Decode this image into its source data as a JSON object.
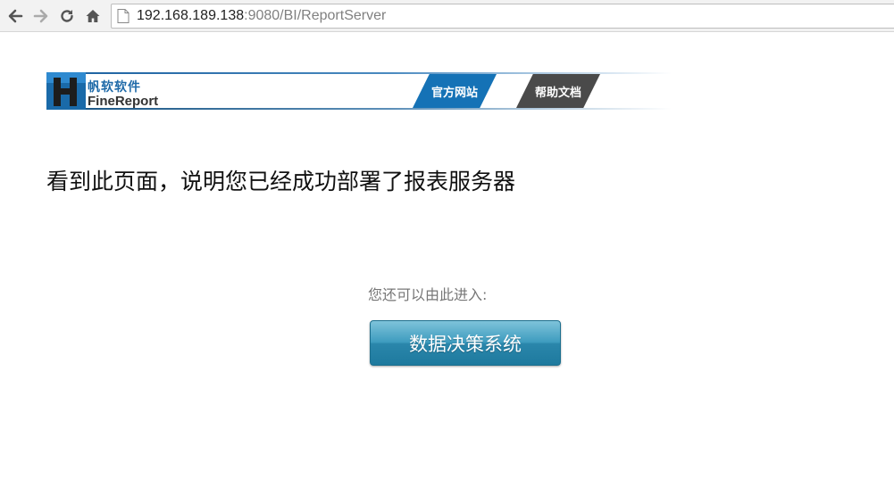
{
  "browser": {
    "url_host": "192.168.189.138",
    "url_rest": ":9080/BI/ReportServer"
  },
  "banner": {
    "brand_cn": "帆软软件",
    "brand_en": "FineReport",
    "tab_official": "官方网站",
    "tab_help": "帮助文档"
  },
  "main": {
    "message": "看到此页面，说明您已经成功部署了报表服务器",
    "enter_hint": "您还可以由此进入:",
    "decision_button": "数据决策系统"
  },
  "colors": {
    "brand_blue": "#1572b6",
    "help_tab": "#4a4a4a",
    "button_top": "#7ec3da",
    "button_bottom": "#1e7a9e"
  }
}
